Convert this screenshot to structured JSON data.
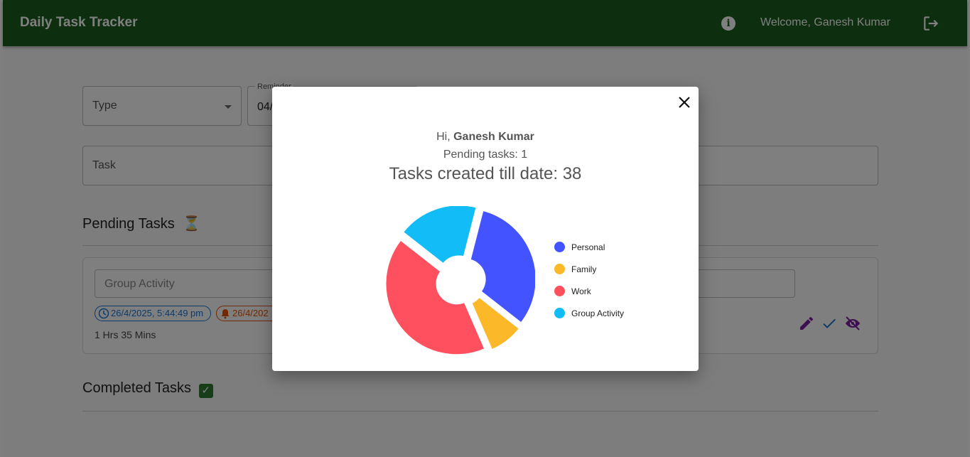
{
  "header": {
    "title": "Daily Task Tracker",
    "welcome": "Welcome, Ganesh Kumar",
    "info_icon": "info-icon",
    "logout_icon": "logout-icon"
  },
  "form": {
    "type_label": "Type",
    "reminder_label": "Reminder",
    "reminder_value": "04/",
    "task_label": "Task"
  },
  "pending": {
    "title": "Pending Tasks",
    "emoji": "⏳",
    "task": {
      "name": "Group Activity",
      "created": "26/4/2025, 5:44:49 pm",
      "reminder": "26/4/202",
      "duration": "1 Hrs 35 Mins"
    }
  },
  "completed": {
    "title": "Completed Tasks",
    "emoji": "✅"
  },
  "modal": {
    "greeting_prefix": "Hi, ",
    "user_name": "Ganesh Kumar",
    "pending_text": "Pending tasks: 1",
    "created_text": "Tasks created till date: 38"
  },
  "chart_data": {
    "type": "pie",
    "title": "",
    "categories": [
      "Personal",
      "Family",
      "Work",
      "Group Activity"
    ],
    "values": [
      12,
      3,
      16,
      7
    ],
    "colors": [
      "#4353ff",
      "#fbb829",
      "#ff5060",
      "#12bcf6"
    ],
    "donut": true,
    "legend": "right"
  }
}
